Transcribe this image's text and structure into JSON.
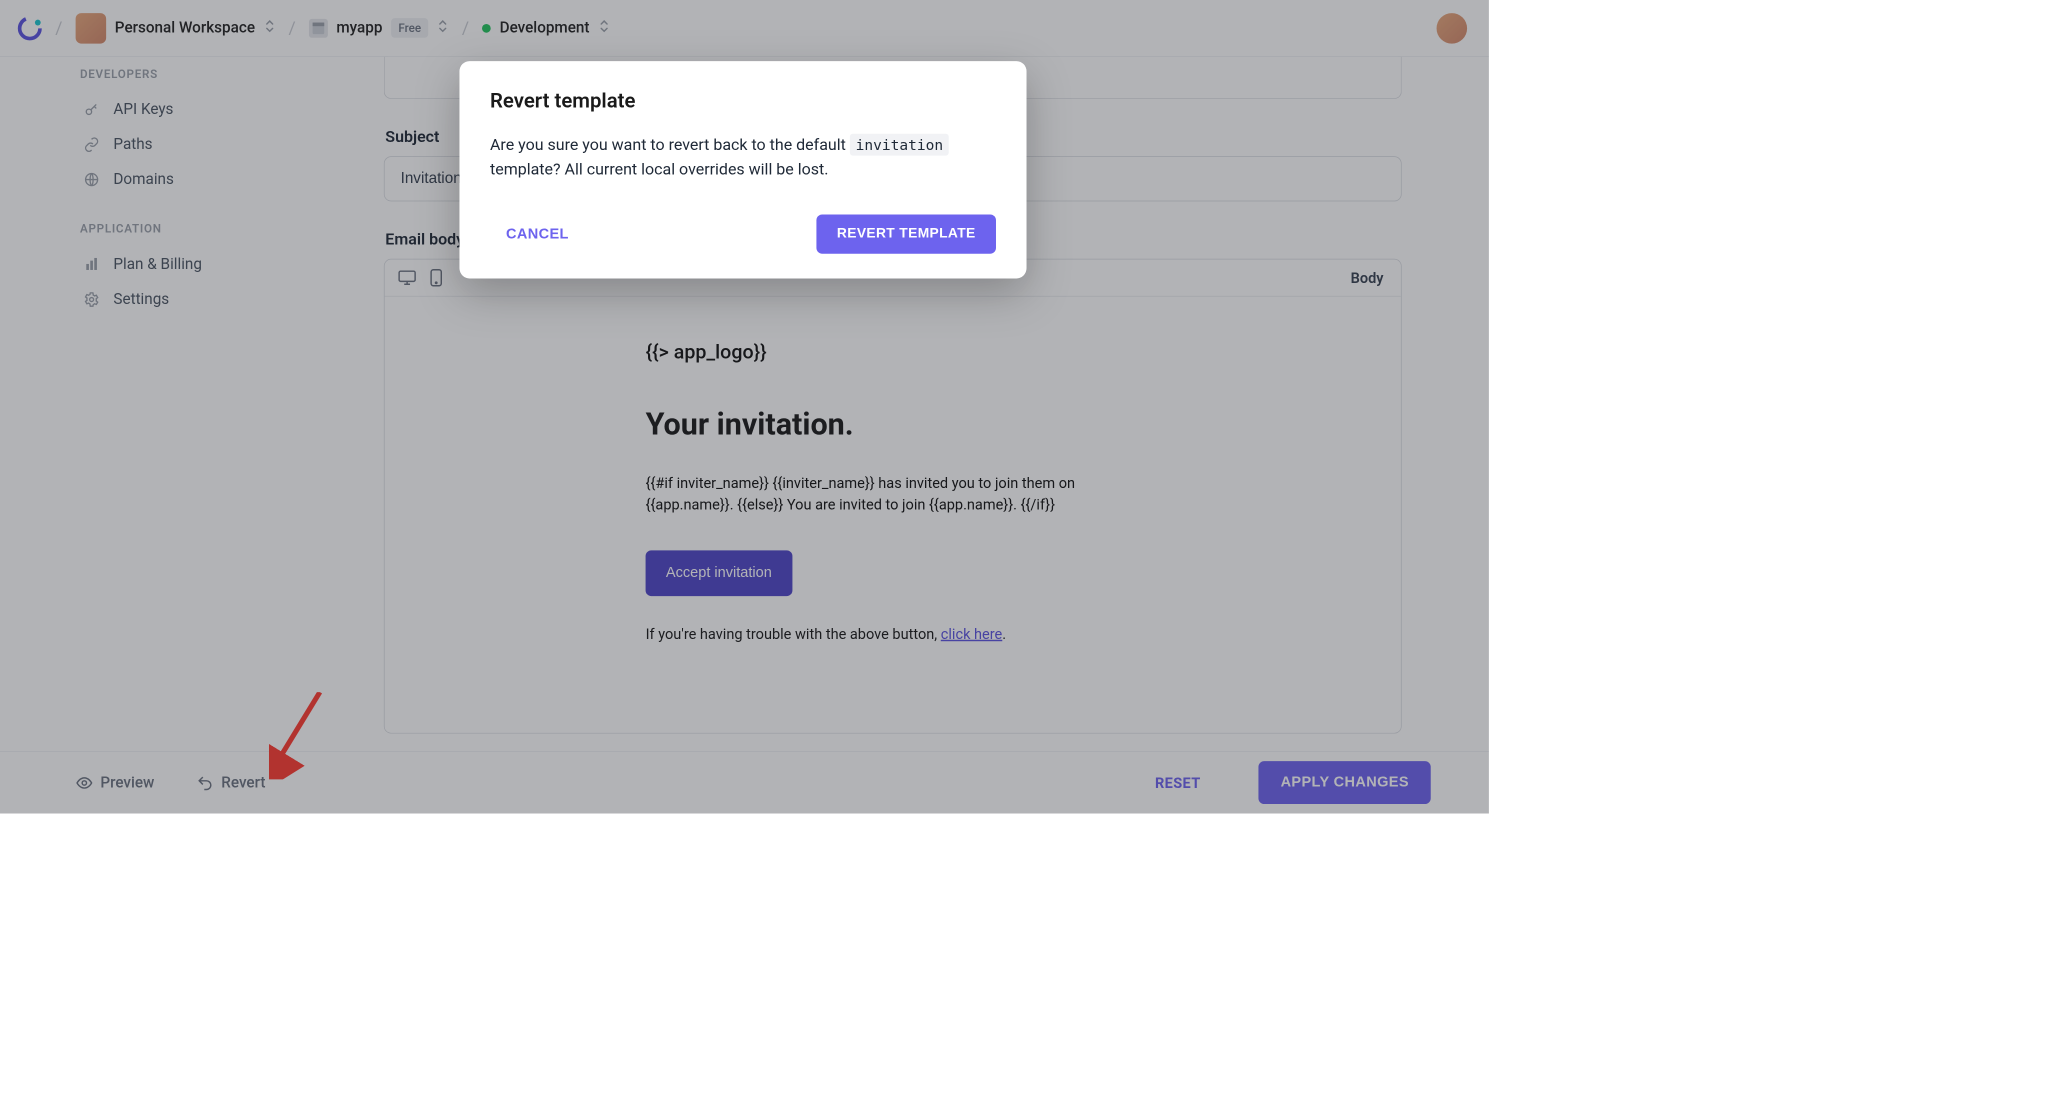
{
  "topbar": {
    "workspace_name": "Personal Workspace",
    "app_name": "myapp",
    "app_plan_badge": "Free",
    "env_name": "Development"
  },
  "sidebar": {
    "groups": [
      {
        "label": "DEVELOPERS",
        "items": [
          {
            "icon": "key-icon",
            "label": "API Keys"
          },
          {
            "icon": "link-icon",
            "label": "Paths"
          },
          {
            "icon": "globe-icon",
            "label": "Domains"
          }
        ]
      },
      {
        "label": "APPLICATION",
        "items": [
          {
            "icon": "bars-icon",
            "label": "Plan & Billing"
          },
          {
            "icon": "gear-icon",
            "label": "Settings"
          }
        ]
      }
    ]
  },
  "main": {
    "subject_label": "Subject",
    "subject_value": "Invitation",
    "body_label": "Email body",
    "toolbar_tab": "Body",
    "email": {
      "logo_token": "{{> app_logo}}",
      "heading": "Your invitation.",
      "paragraph": "{{#if inviter_name}} {{inviter_name}} has invited you to join them on {{app.name}}. {{else}} You are invited to join {{app.name}}. {{/if}}",
      "cta_label": "Accept invitation",
      "trouble_prefix": "If you're having trouble with the above button, ",
      "trouble_link": "click here",
      "trouble_suffix": "."
    }
  },
  "footer": {
    "preview_label": "Preview",
    "revert_label": "Revert",
    "reset_label": "RESET",
    "apply_label": "APPLY CHANGES"
  },
  "modal": {
    "title": "Revert template",
    "body_pre": "Are you sure you want to revert back to the default ",
    "code_token": "invitation",
    "body_post": " template? All current local overrides will be lost.",
    "cancel_label": "CANCEL",
    "confirm_label": "REVERT TEMPLATE"
  },
  "colors": {
    "accent": "#6d63ee",
    "accent_dark": "#4f46c8",
    "text": "#1f2937",
    "muted": "#9aa0aa",
    "status_green": "#22c55e"
  }
}
